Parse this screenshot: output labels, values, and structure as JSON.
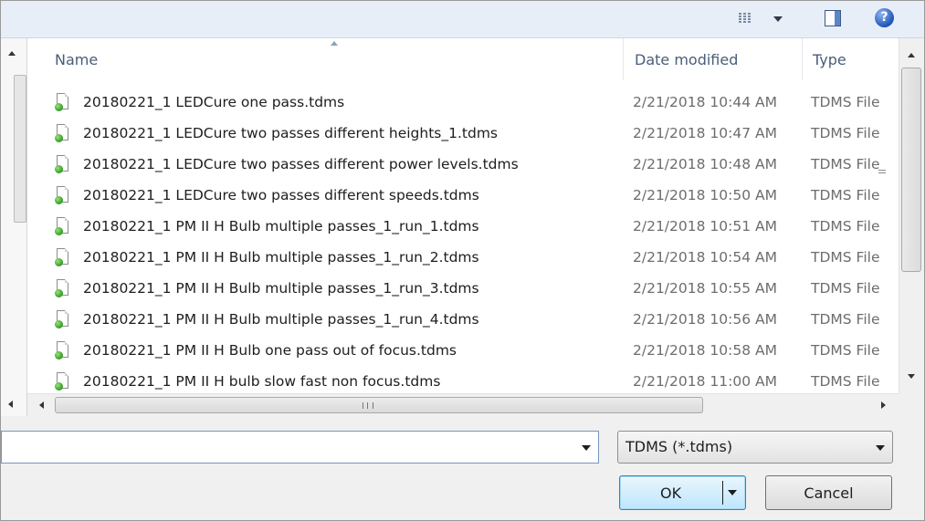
{
  "toolbar": {
    "view_icon": "details-view-icon",
    "preview_icon": "preview-pane-icon",
    "help_icon": "help-icon",
    "help_glyph": "?"
  },
  "columns": {
    "name": "Name",
    "date": "Date modified",
    "type": "Type"
  },
  "files": [
    {
      "name": "20180221_1 LEDCure one pass.tdms",
      "date": "2/21/2018 10:44 AM",
      "type": "TDMS File"
    },
    {
      "name": "20180221_1 LEDCure two passes different heights_1.tdms",
      "date": "2/21/2018 10:47 AM",
      "type": "TDMS File"
    },
    {
      "name": "20180221_1 LEDCure two passes different power levels.tdms",
      "date": "2/21/2018 10:48 AM",
      "type": "TDMS File"
    },
    {
      "name": "20180221_1 LEDCure two passes different speeds.tdms",
      "date": "2/21/2018 10:50 AM",
      "type": "TDMS File"
    },
    {
      "name": "20180221_1 PM II H Bulb multiple passes_1_run_1.tdms",
      "date": "2/21/2018 10:51 AM",
      "type": "TDMS File"
    },
    {
      "name": "20180221_1 PM II H Bulb multiple passes_1_run_2.tdms",
      "date": "2/21/2018 10:54 AM",
      "type": "TDMS File"
    },
    {
      "name": "20180221_1 PM II H Bulb multiple passes_1_run_3.tdms",
      "date": "2/21/2018 10:55 AM",
      "type": "TDMS File"
    },
    {
      "name": "20180221_1 PM II H Bulb multiple passes_1_run_4.tdms",
      "date": "2/21/2018 10:56 AM",
      "type": "TDMS File"
    },
    {
      "name": "20180221_1 PM II H Bulb one pass out of focus.tdms",
      "date": "2/21/2018 10:58 AM",
      "type": "TDMS File"
    },
    {
      "name": "20180221_1 PM II H bulb slow fast non focus.tdms",
      "date": "2/21/2018 11:00 AM",
      "type": "TDMS File"
    }
  ],
  "file_name_field": {
    "value": ""
  },
  "file_type_filter": {
    "selected": "TDMS (*.tdms)"
  },
  "buttons": {
    "ok": "OK",
    "cancel": "Cancel"
  },
  "colors": {
    "accent": "#3c7fb1",
    "ok_fill": "#bee6fd"
  }
}
